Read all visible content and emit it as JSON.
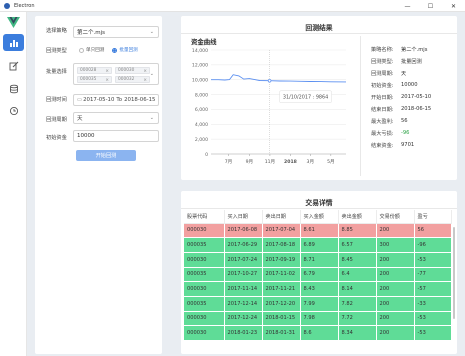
{
  "window": {
    "title": "Electron",
    "minimize": "—",
    "maximize": "☐",
    "close": "✕"
  },
  "form": {
    "strategy_label": "选择策略",
    "strategy_value": "第二个.mjs",
    "type_label": "回测类型",
    "type_options": [
      "单只回测",
      "批量回测"
    ],
    "type_selected": 1,
    "batch_label": "批量选择",
    "batch_tags": [
      "000028",
      "000030",
      "000035",
      "000032"
    ],
    "time_label": "回测时间",
    "date_start": "2017-05-10",
    "date_sep": "To",
    "date_end": "2018-06-15",
    "period_label": "回测周期",
    "period_value": "天",
    "capital_label": "初始资金",
    "capital_value": "10000",
    "start_button": "开始回测"
  },
  "result": {
    "title": "回测结果",
    "chart_title": "资金曲线",
    "tooltip": "31/10/2017 : 9864",
    "info": [
      {
        "k": "策略名称:",
        "v": "第二个.mjs"
      },
      {
        "k": "回测类型:",
        "v": "批量回测"
      },
      {
        "k": "回测周期:",
        "v": "天"
      },
      {
        "k": "初始资金:",
        "v": "10000"
      },
      {
        "k": "开始日期:",
        "v": "2017-05-10"
      },
      {
        "k": "结束日期:",
        "v": "2018-06-15"
      },
      {
        "k": "最大盈利:",
        "v": "56"
      },
      {
        "k": "最大亏损:",
        "v": "-96"
      },
      {
        "k": "结束资金:",
        "v": "9701"
      }
    ]
  },
  "chart_data": {
    "type": "line",
    "title": "资金曲线",
    "ylim": [
      0,
      14000
    ],
    "yticks": [
      "14,000",
      "12,000",
      "10,000",
      "8,000",
      "6,000",
      "4,000",
      "2,000",
      "0"
    ],
    "xticks": [
      "7月",
      "9月",
      "11月",
      "2018",
      "3月",
      "5月"
    ],
    "x": [
      "2017-05-10",
      "2017-06-01",
      "2017-06-20",
      "2017-07-04",
      "2017-07-15",
      "2017-08-01",
      "2017-08-15",
      "2017-09-01",
      "2017-09-15",
      "2017-10-01",
      "2017-10-31",
      "2017-12-01",
      "2018-01-01",
      "2018-02-01",
      "2018-03-01",
      "2018-04-01",
      "2018-05-01",
      "2018-06-15"
    ],
    "series": [
      {
        "values": [
          10000,
          10000,
          9960,
          10020,
          10680,
          10520,
          10080,
          10150,
          10040,
          9900,
          9864,
          9830,
          9810,
          9790,
          9760,
          9740,
          9720,
          9701
        ]
      }
    ],
    "tooltip_point": {
      "x": "2017-10-31",
      "y": 9864
    },
    "line_color": "#5b8ff0"
  },
  "trades": {
    "title": "交易详情",
    "columns": [
      "股票代码",
      "买入日期",
      "卖出日期",
      "买入金额",
      "卖出金额",
      "交易份额",
      "盈亏"
    ],
    "rows": [
      {
        "code": "000030",
        "buy": "2017-06-08",
        "sell": "2017-07-04",
        "bamt": "8.61",
        "samt": "8.85",
        "qty": "200",
        "pl": "56",
        "status": "loss"
      },
      {
        "code": "000035",
        "buy": "2017-06-29",
        "sell": "2017-08-18",
        "bamt": "6.89",
        "samt": "6.57",
        "qty": "300",
        "pl": "-96",
        "status": "win"
      },
      {
        "code": "000030",
        "buy": "2017-07-24",
        "sell": "2017-09-19",
        "bamt": "8.71",
        "samt": "8.45",
        "qty": "200",
        "pl": "-53",
        "status": "win"
      },
      {
        "code": "000035",
        "buy": "2017-10-27",
        "sell": "2017-11-02",
        "bamt": "6.79",
        "samt": "6.4",
        "qty": "200",
        "pl": "-77",
        "status": "win"
      },
      {
        "code": "000030",
        "buy": "2017-11-14",
        "sell": "2017-11-21",
        "bamt": "8.43",
        "samt": "8.14",
        "qty": "200",
        "pl": "-57",
        "status": "win"
      },
      {
        "code": "000035",
        "buy": "2017-12-14",
        "sell": "2017-12-20",
        "bamt": "7.99",
        "samt": "7.82",
        "qty": "200",
        "pl": "-33",
        "status": "win"
      },
      {
        "code": "000030",
        "buy": "2017-12-24",
        "sell": "2018-01-15",
        "bamt": "7.98",
        "samt": "7.72",
        "qty": "200",
        "pl": "-53",
        "status": "win"
      },
      {
        "code": "000030",
        "buy": "2018-01-23",
        "sell": "2018-01-31",
        "bamt": "8.6",
        "samt": "8.34",
        "qty": "200",
        "pl": "-53",
        "status": "win"
      }
    ]
  }
}
